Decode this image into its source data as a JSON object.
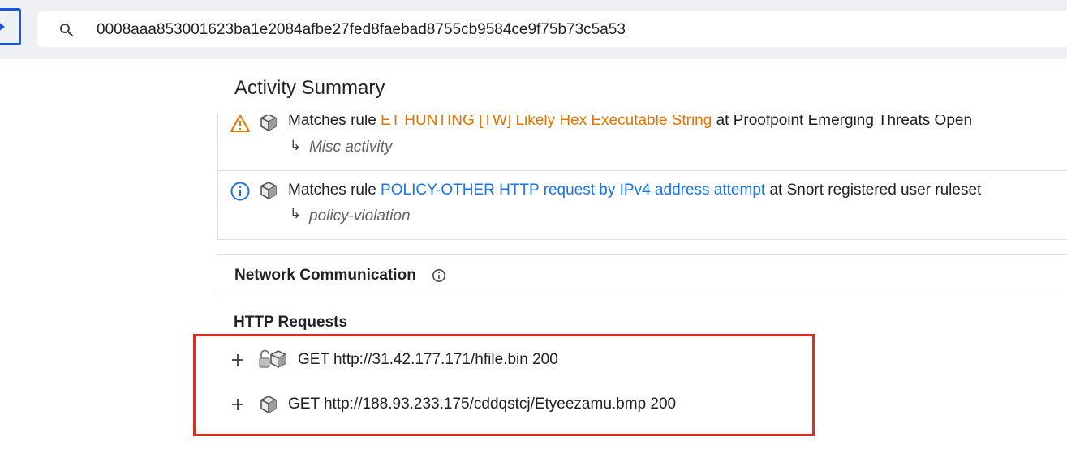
{
  "search": {
    "value": "0008aaa853001623ba1e2084afbe27fed8faebad8755cb9584ce9f75b73c5a53"
  },
  "page": {
    "title": "Activity Summary"
  },
  "rules": [
    {
      "prefix": "Matches rule ",
      "rule_name": "ET HUNTING [TW] Likely Hex Executable String",
      "suffix": " at Proofpoint Emerging Threats Open",
      "category": "Misc activity",
      "severity_icon": "warning-icon",
      "color": "#e37400"
    },
    {
      "prefix": "Matches rule ",
      "rule_name": "POLICY-OTHER HTTP request by IPv4 address attempt",
      "suffix": " at Snort registered user ruleset",
      "category": "policy-violation",
      "severity_icon": "info-icon",
      "color": "#1a73e8"
    }
  ],
  "network": {
    "title": "Network Communication"
  },
  "http": {
    "title": "HTTP Requests",
    "requests": [
      {
        "text": "GET http://31.42.177.171/hfile.bin 200"
      },
      {
        "text": "GET http://188.93.233.175/cddqstcj/Etyeezamu.bmp 200"
      }
    ]
  },
  "colors": {
    "highlight_box": "#d93025",
    "nav_accent": "#1a56db"
  }
}
